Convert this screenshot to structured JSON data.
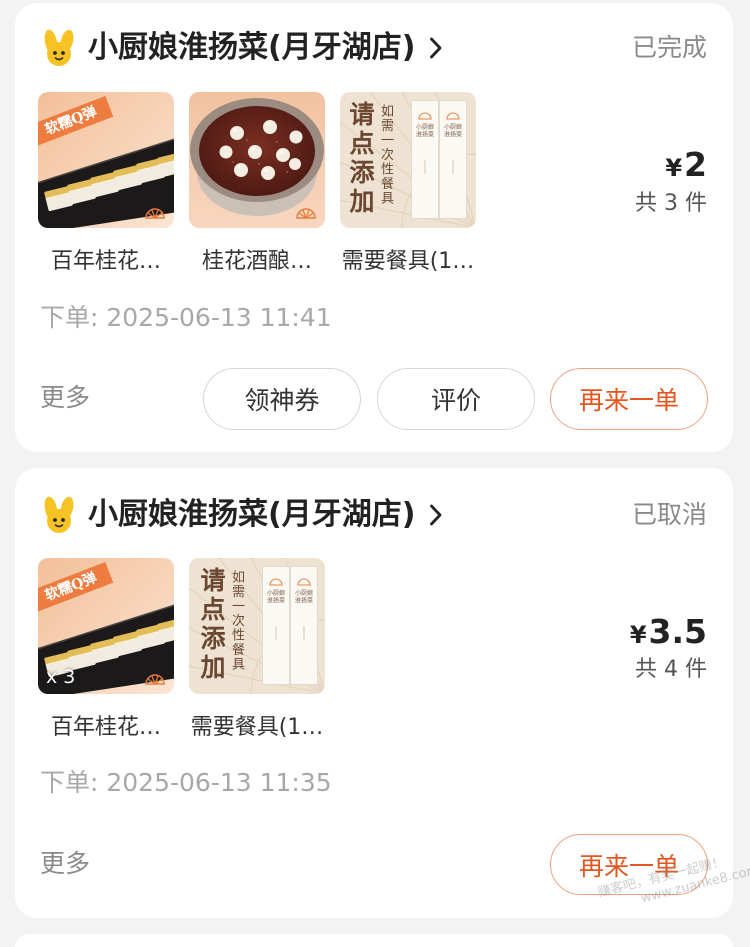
{
  "colors": {
    "page_bg": "#f3f3f3",
    "card_bg": "#ffffff",
    "text": "#222222",
    "accent": "#e3561d",
    "accent_border": "#f0a27f",
    "brand_yellow": "#f6c224"
  },
  "icons": {
    "store_logo": "store-logo-icon",
    "store_link": "chevron-right-icon",
    "brand_mark": "fan-icon"
  },
  "orders": [
    {
      "store_name": "小厨娘淮扬菜(月牙湖店)",
      "status": "已完成",
      "items": [
        {
          "name": "百年桂花…",
          "ribbon": "软糯Q弹"
        },
        {
          "name": "桂花酒酿…"
        },
        {
          "name": "需要餐具(1…",
          "big_text": "请点添加",
          "small_text": "如需一次性餐具",
          "pack_line1": "小厨娘",
          "pack_line2": "淮扬菜"
        }
      ],
      "price_symbol": "¥",
      "price_value": "2",
      "count_text": "共 3 件",
      "order_time": "下单: 2025-06-13 11:41",
      "more_label": "更多",
      "actions": [
        "领神券",
        "评价",
        "再来一单"
      ]
    },
    {
      "store_name": "小厨娘淮扬菜(月牙湖店)",
      "status": "已取消",
      "items": [
        {
          "name": "百年桂花…",
          "ribbon": "软糯Q弹",
          "quantity": "x 3"
        },
        {
          "name": "需要餐具(1…",
          "big_text": "请点添加",
          "small_text": "如需一次性餐具",
          "pack_line1": "小厨娘",
          "pack_line2": "淮扬菜"
        }
      ],
      "price_symbol": "¥",
      "price_value": "3.5",
      "count_text": "共 4 件",
      "order_time": "下单: 2025-06-13 11:35",
      "more_label": "更多",
      "actions": [
        "再来一单"
      ]
    }
  ],
  "watermark": {
    "line1": "赚客吧，有奖一起赚！",
    "line2": "www.zuanke8.com"
  }
}
